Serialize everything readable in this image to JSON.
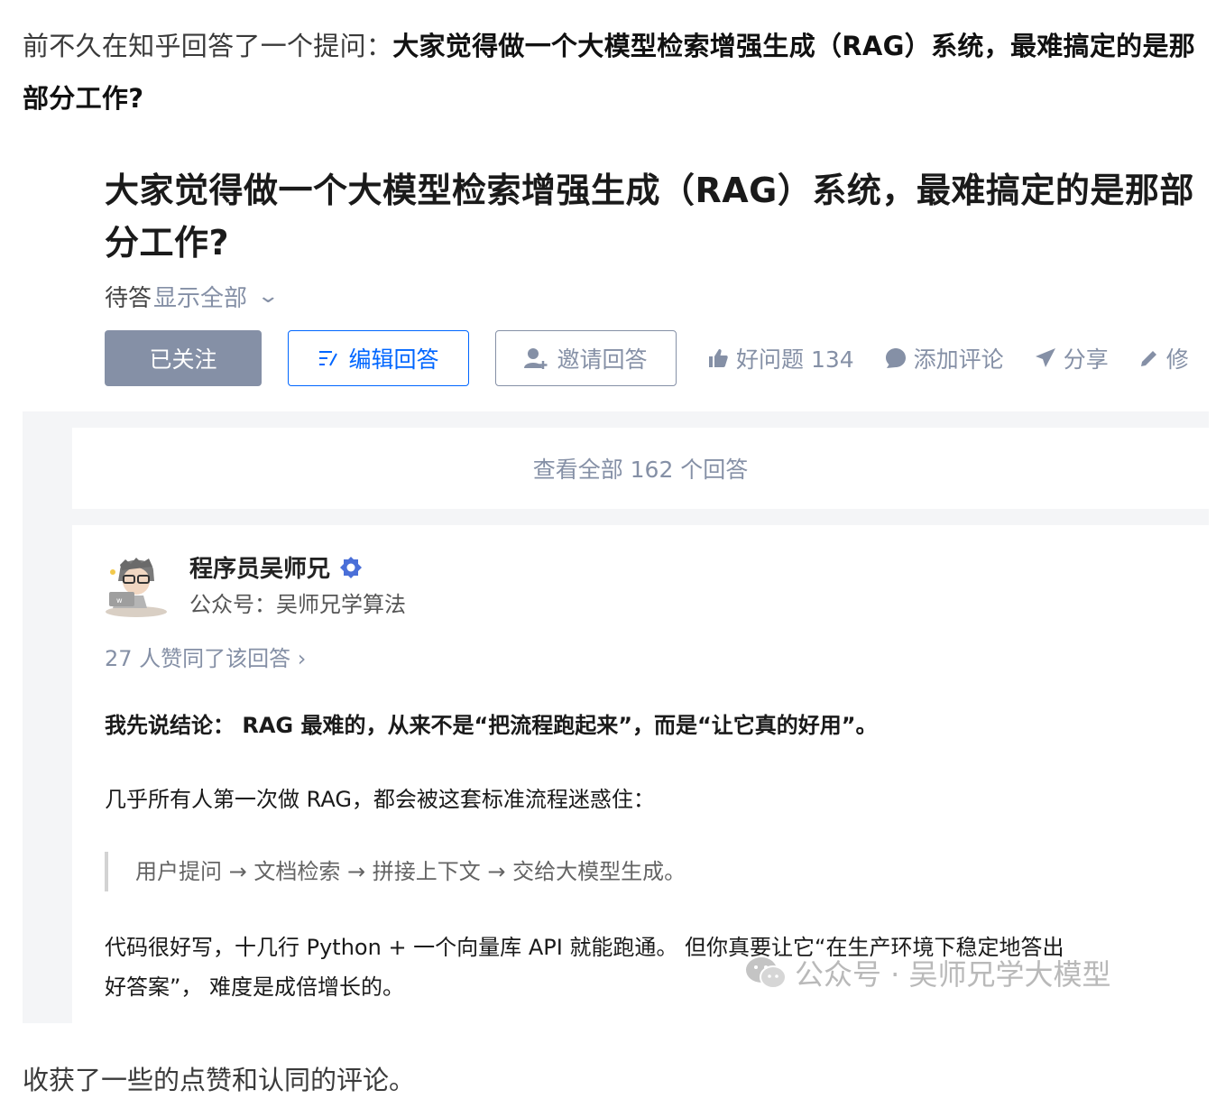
{
  "intro": {
    "prefix": "前不久在知乎回答了一个提问：",
    "question_bold": "大家觉得做一个大模型检索增强生成（RAG）系统，最难搞定的是那部分工作?"
  },
  "question": {
    "title": "大家觉得做一个大模型检索增强生成（RAG）系统，最难搞定的是那部分工作?",
    "pending_label": "待答",
    "show_all": "显示全部"
  },
  "actions": {
    "follow": "已关注",
    "edit_answer": "编辑回答",
    "invite_answer": "邀请回答",
    "good_question": "好问题 134",
    "add_comment": "添加评论",
    "share": "分享",
    "modify_partial": "修"
  },
  "view_all_answers": "查看全部 162 个回答",
  "answer": {
    "author_name": "程序员吴师兄",
    "author_subtitle": "公众号：吴师兄学算法",
    "votes": "27 人赞同了该回答 ›",
    "p1": "我先说结论： RAG 最难的，从来不是“把流程跑起来”，而是“让它真的好用”。",
    "p2": "几乎所有人第一次做 RAG，都会被这套标准流程迷惑住：",
    "quote": "用户提问 → 文档检索 → 拼接上下文 → 交给大模型生成。",
    "p3_line1": "代码很好写，十几行 Python + 一个向量库 API 就能跑通。 但你真要让它“在生产环境下稳定地答出",
    "p3_line2": "好答案”， 难度是成倍增长的。",
    "watermark": "公众号 · 吴师兄学大模型"
  },
  "outro": "收获了一些的点赞和认同的评论。",
  "colors": {
    "accent_blue": "#0066ff",
    "muted_gray": "#8590a6",
    "page_bg": "#f4f5f7"
  },
  "icons": [
    "edit-icon",
    "invite-user-icon",
    "thumbs-up-icon",
    "comment-icon",
    "share-icon",
    "pencil-icon",
    "verified-badge-icon",
    "wechat-icon",
    "chevron-down-icon"
  ]
}
